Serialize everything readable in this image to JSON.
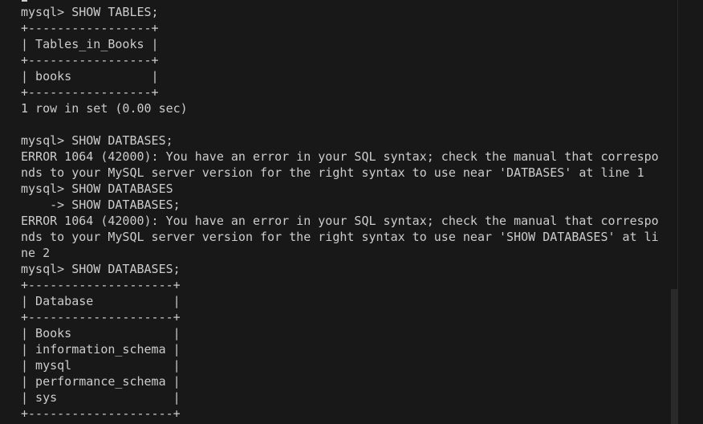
{
  "terminal": {
    "lines": [
      "mysql> SHOW TABLES;",
      "+-----------------+",
      "| Tables_in_Books |",
      "+-----------------+",
      "| books           |",
      "+-----------------+",
      "1 row in set (0.00 sec)",
      "",
      "mysql> SHOW DATBASES;",
      "ERROR 1064 (42000): You have an error in your SQL syntax; check the manual that correspo",
      "nds to your MySQL server version for the right syntax to use near 'DATBASES' at line 1",
      "mysql> SHOW DATABASES",
      "    -> SHOW DATABASES;",
      "ERROR 1064 (42000): You have an error in your SQL syntax; check the manual that correspo",
      "nds to your MySQL server version for the right syntax to use near 'SHOW DATABASES' at li",
      "ne 2",
      "mysql> SHOW DATABASES;",
      "+--------------------+",
      "| Database           |",
      "+--------------------+",
      "| Books              |",
      "| information_schema |",
      "| mysql              |",
      "| performance_schema |",
      "| sys                |",
      "+--------------------+"
    ]
  }
}
